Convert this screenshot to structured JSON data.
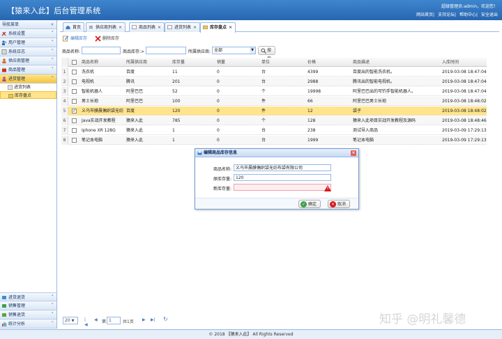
{
  "header": {
    "title": "【猿来入此】后台管理系统",
    "welcome": "超级管理员:admin，欢迎您！",
    "links": [
      "网站首页",
      "支持论坛",
      "帮助中心",
      "安全退出"
    ]
  },
  "sidebar": {
    "header": "导航菜单",
    "sections_top": [
      "系统设置",
      "用户管理",
      "系统日志",
      "供应商管理",
      "商品管理",
      "进货管理"
    ],
    "sub_items": [
      "进货列表",
      "库存盘点"
    ],
    "sections_bottom": [
      "进货退货",
      "销售管理",
      "销售退货",
      "统计分析"
    ]
  },
  "tabs": [
    "首页",
    "供应商列表",
    "商品列表",
    "进货列表",
    "库存盘点"
  ],
  "toolbar": {
    "edit": "编辑库存",
    "delete": "删除库存"
  },
  "search": {
    "name_label": "商品名称:",
    "stock_label": "商品库存:>",
    "supplier_label": "所属供应商:",
    "supplier_value": "全部",
    "search_button": "搜索"
  },
  "grid": {
    "columns": [
      "商品名称",
      "所属供应商",
      "库存量",
      "销量",
      "单位",
      "价格",
      "商品描述",
      "入库时间"
    ],
    "rows": [
      [
        "洗衣机",
        "百度",
        "11",
        "0",
        "台",
        "4399",
        "百度出的智能洗衣机。",
        "2019-03-08 18:47:04"
      ],
      [
        "电视机",
        "腾讯",
        "201",
        "0",
        "台",
        "2988",
        "腾讯出的智能电视机。",
        "2019-03-08 18:47:04"
      ],
      [
        "智能机器人",
        "阿里巴巴",
        "52",
        "0",
        "个",
        "19998",
        "阿里巴巴出的可钓手智能机器人。",
        "2019-03-08 18:47:04"
      ],
      [
        "男士长袍",
        "阿里巴巴",
        "100",
        "0",
        "件",
        "66",
        "阿里巴巴男士长袍",
        "2019-03-08 18:48:02"
      ],
      [
        "义乌市膜晨偶织袋无纺",
        "百度",
        "120",
        "0",
        "件",
        "12",
        "袋子",
        "2019-03-08 18:48:02"
      ],
      [
        "Java实战开发教程",
        "猿来入此",
        "785",
        "0",
        "个",
        "128",
        "猿来入此项目实战开发教程及源码",
        "2019-03-08 18:48:46"
      ],
      [
        "Iphone XR 128G",
        "猿来入此",
        "1",
        "0",
        "台",
        "238",
        "测试导入商品",
        "2019-03-09 17:29:13"
      ],
      [
        "笔记本电脑",
        "猿来入此",
        "1",
        "0",
        "台",
        "1999",
        "笔记本电脑",
        "2019-03-09 17:29:13"
      ]
    ],
    "row_numbers": [
      "1",
      "2",
      "3",
      "4",
      "5",
      "6",
      "7",
      "8"
    ],
    "selected_row": 5
  },
  "dialog": {
    "title": "编辑商品库存信息",
    "name_label": "商品名称:",
    "name_value": "义乌市晨膜偶织袋无纺布袋有限公司",
    "old_stock_label": "原库存量:",
    "old_stock_value": "120",
    "new_stock_label": "新库存量:",
    "new_stock_value": "",
    "ok_label": "确定",
    "cancel_label": "取消"
  },
  "pager": {
    "page_size": "20",
    "page_prefix": "第",
    "page_value": "1",
    "page_suffix": "共1页"
  },
  "watermark": "知乎 @明礼馨德",
  "footer": "© 2018 【猿来入此】 All Rights Reserved",
  "colors": {
    "banner": "#2e72bf",
    "selected": "#ffe48d",
    "border": "#95b8e7",
    "warn": "#d7151b"
  }
}
